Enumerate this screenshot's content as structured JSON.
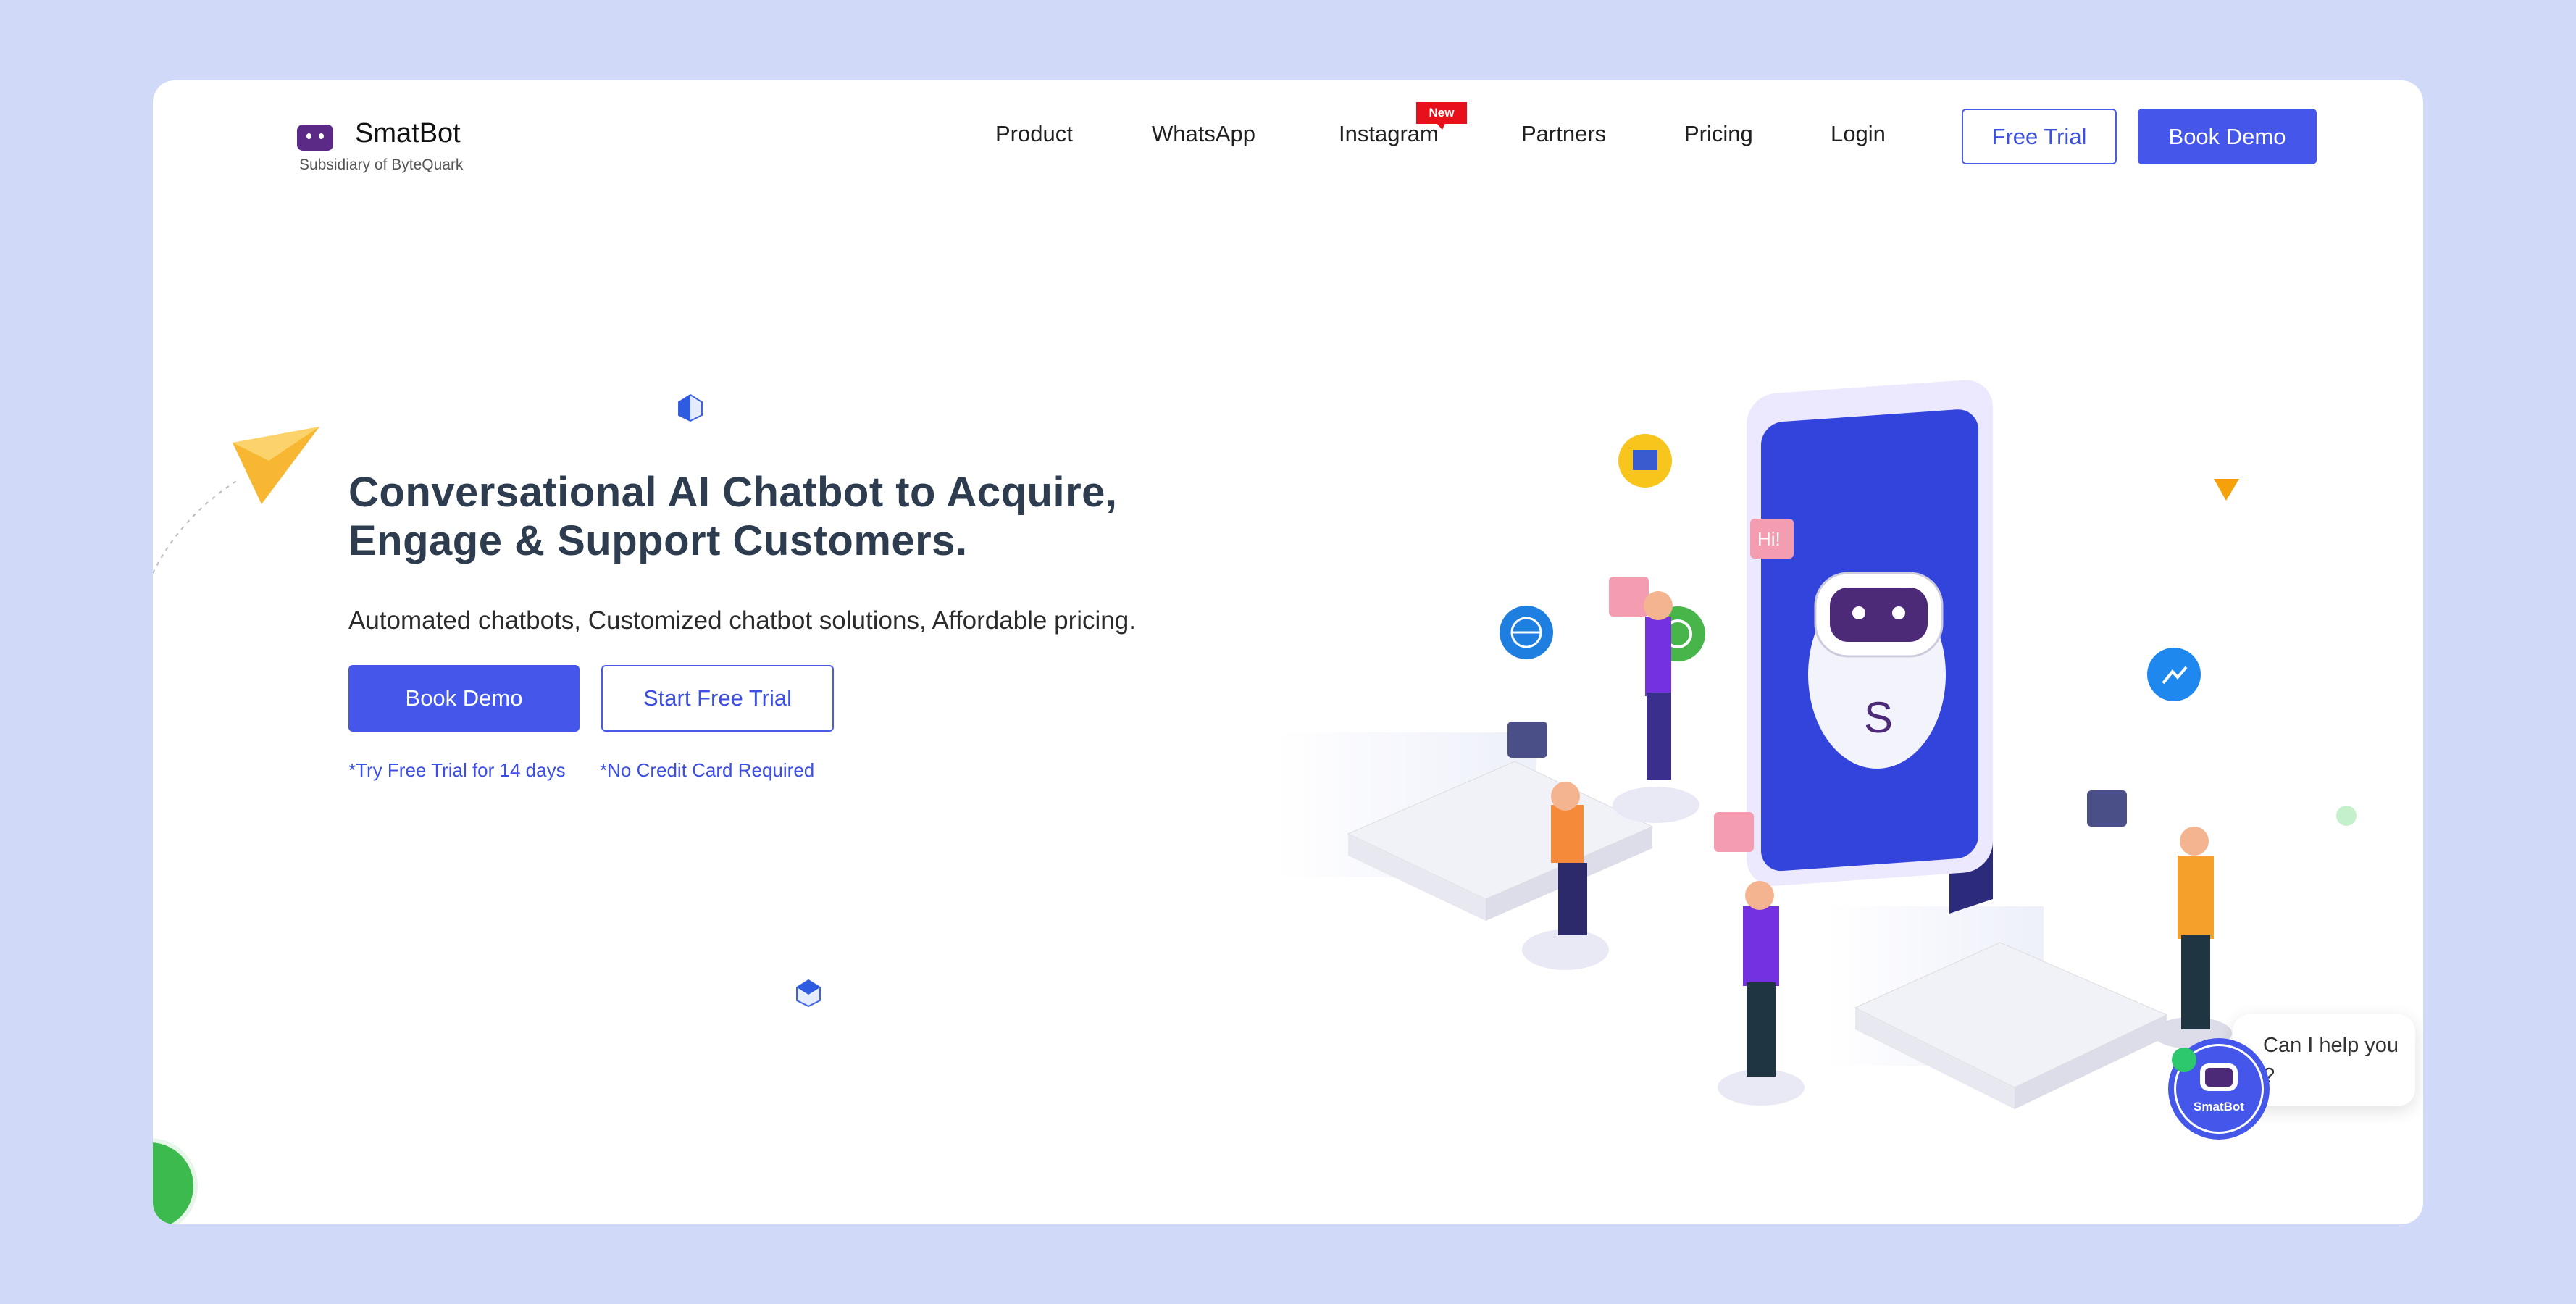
{
  "brand": {
    "name": "SmatBot",
    "subtitle": "Subsidiary of ByteQuark"
  },
  "nav": {
    "items": [
      {
        "label": "Product"
      },
      {
        "label": "WhatsApp"
      },
      {
        "label": "Instagram",
        "badge": "New"
      },
      {
        "label": "Partners"
      },
      {
        "label": "Pricing"
      },
      {
        "label": "Login"
      }
    ],
    "free_trial": "Free Trial",
    "book_demo": "Book Demo"
  },
  "hero": {
    "title_line1": "Conversational AI Chatbot to Acquire,",
    "title_line2": "Engage & Support Customers.",
    "subtitle": "Automated chatbots, Customized chatbot solutions, Affordable pricing.",
    "book_demo": "Book Demo",
    "start_trial": "Start Free Trial",
    "note1": "*Try Free Trial for 14 days",
    "note2": "*No Credit Card Required"
  },
  "chat_widget": {
    "bubble": "Can I help you ?",
    "label": "SmatBot"
  },
  "colors": {
    "primary": "#4557ea",
    "brand_purple": "#5b2a86",
    "badge_red": "#e8101a",
    "online_green": "#2dc76d",
    "background": "#d0daf8"
  },
  "icons": [
    "robot-logo-icon",
    "paper-plane-icon",
    "globe-icon",
    "whatsapp-icon",
    "messenger-icon",
    "chat-bubble-icon"
  ]
}
